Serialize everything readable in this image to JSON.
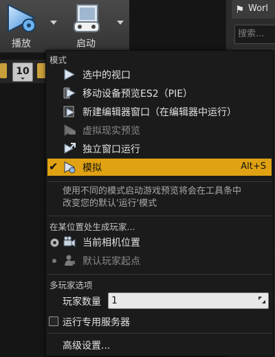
{
  "toolbar": {
    "play_label": "播放",
    "launch_label": "启动"
  },
  "viewport_strip": {
    "value": "10"
  },
  "right_panel": {
    "tab_label": "Worl",
    "search_placeholder": "搜索..."
  },
  "menu": {
    "modes_title": "模式",
    "modes": [
      {
        "label": "选中的视口",
        "icon": "play-triangle-icon",
        "enabled": true
      },
      {
        "label": "移动设备预览ES2（PIE）",
        "icon": "mobile-preview-icon",
        "enabled": true
      },
      {
        "label": "新建编辑器窗口（在编辑器中运行）",
        "icon": "new-window-icon",
        "enabled": true
      },
      {
        "label": "虚拟现实预览",
        "icon": "vr-headset-icon",
        "enabled": false
      },
      {
        "label": "独立窗口运行",
        "icon": "standalone-icon",
        "enabled": true
      },
      {
        "label": "模拟",
        "icon": "simulate-icon",
        "enabled": true,
        "selected": true,
        "shortcut": "Alt+S"
      }
    ],
    "hint_lines": [
      "使用不同的模式启动游戏预览将会在工具条中",
      "改变您的默认'运行'模式"
    ],
    "spawn_title": "在某位置处生成玩家...",
    "spawn_options": [
      {
        "label": "当前相机位置",
        "icon": "camera-icon",
        "checked": true,
        "enabled": true
      },
      {
        "label": "默认玩家起点",
        "icon": "player-start-icon",
        "checked": false,
        "enabled": false
      }
    ],
    "multiplayer_title": "多玩家选项",
    "player_count_label": "玩家数量",
    "player_count_value": "1",
    "dedicated_server_label": "运行专用服务器",
    "dedicated_server_checked": false,
    "advanced_label": "高级设置...",
    "colors": {
      "highlight": "#e0a212",
      "background": "#1b1b1b"
    }
  }
}
